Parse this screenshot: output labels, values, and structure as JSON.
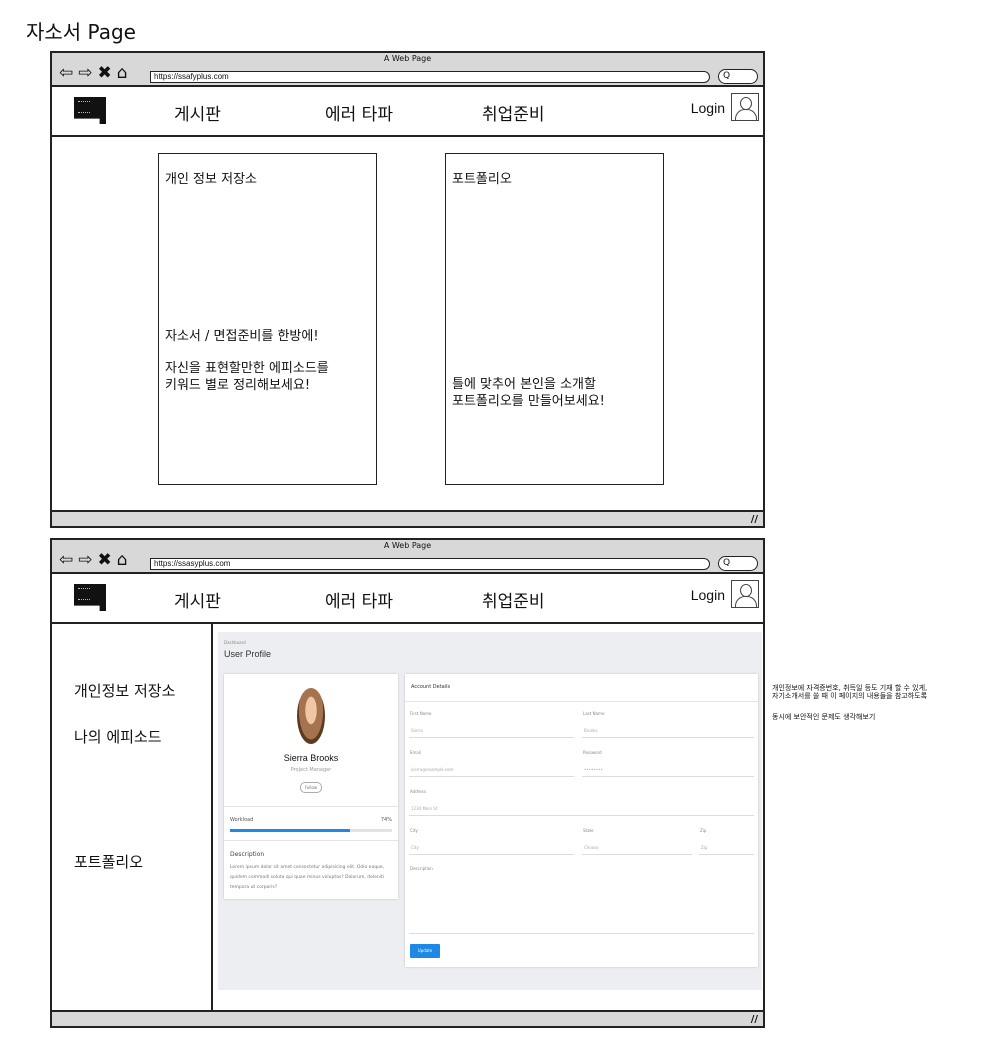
{
  "page_title": "자소서 Page",
  "browser": {
    "window_title": "A Web Page",
    "url_1": "https://ssafyplus.com",
    "url_2": "https://ssasyplus.com",
    "search_glyph": "Q"
  },
  "nav": {
    "items": [
      "게시판",
      "에러 타파",
      "취업준비"
    ],
    "login": "Login"
  },
  "top_section": {
    "card_left": {
      "title": "개인 정보 저장소",
      "line1": "자소서 / 면접준비를 한방에!",
      "line2": "자신을 표현할만한 에피소드를",
      "line3": "키워드 별로 정리해보세요!"
    },
    "card_right": {
      "title": "포트폴리오",
      "line1": "틀에 맞추어 본인을 소개할",
      "line2": "포트폴리오를 만들어보세요!"
    }
  },
  "bottom_section": {
    "left_menu": [
      "개인정보 저장소",
      "나의 에피소드",
      "포트폴리오"
    ],
    "profile": {
      "breadcrumb": "Dashboard",
      "title": "User Profile",
      "name": "Sierra Brooks",
      "role": "Project Manager",
      "follow": "Follow",
      "workload_label": "Workload",
      "workload_pct": "74%",
      "workload_value": 0.74,
      "desc_heading": "Description",
      "desc_text": "Lorem ipsum dolor sit amet consectetur adipisicing elit. Odio eaque, quidem commodi soluta qui quae minus voluptas? Dolorum, deleniti tempora ut corporis?"
    },
    "account": {
      "heading": "Account Details",
      "first_name_label": "First Name",
      "first_name_value": "Sierra",
      "last_name_label": "Last Name",
      "last_name_value": "Brooks",
      "email_label": "Email",
      "email_value": "sierra@example.com",
      "password_label": "Password",
      "password_value": "••••••••",
      "address_label": "Address",
      "address_value": "1234 Main St",
      "city_label": "City",
      "city_value": "City",
      "state_label": "State",
      "state_value": "Choose",
      "zip_label": "Zip",
      "zip_value": "Zip",
      "description_label": "Description",
      "submit": "Update Account"
    }
  },
  "side_note": {
    "line1": "개인정보에 자격증번호, 취득일 등도 기재 할 수 있게,",
    "line2": "자기소개서를 쓸 때 이 페이지의 내용들을 참고하도록",
    "line3": "동시에 보안적인 문제도 생각해보기"
  },
  "icons": [
    "back-arrow-icon",
    "forward-arrow-icon",
    "close-icon",
    "home-icon",
    "search-icon",
    "user-avatar-icon",
    "resize-grip-icon",
    "logo"
  ]
}
